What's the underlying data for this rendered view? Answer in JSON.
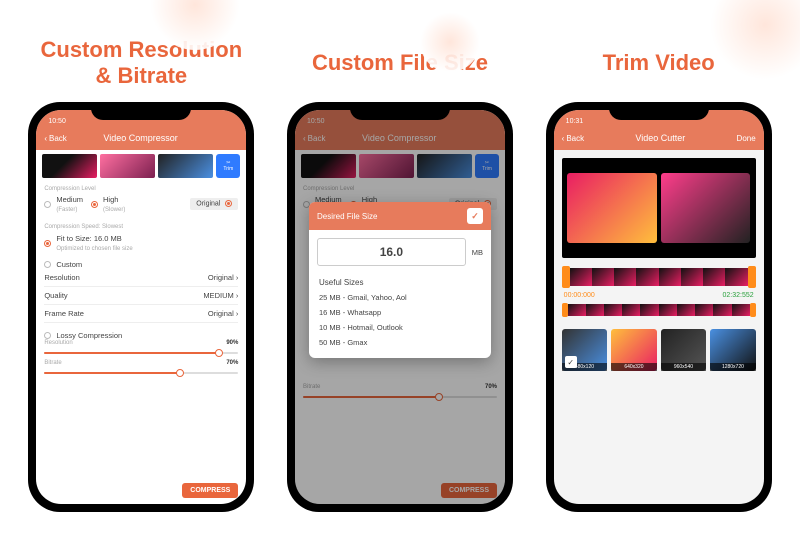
{
  "headlines": {
    "a1": "Custom Resolution",
    "a2": "& Bitrate",
    "b": "Custom File Size",
    "c": "Trim Video"
  },
  "time": {
    "s1": "10:50",
    "s2": "10:50",
    "s3": "10:31"
  },
  "nav": {
    "back": "Back",
    "compressor": "Video Compressor",
    "cutter": "Video Cutter",
    "done": "Done"
  },
  "trimBtn": "Trim",
  "compLevel": {
    "title": "Compression Level",
    "medium": "Medium",
    "medSub": "(Faster)",
    "high": "High",
    "highSub": "(Slower)",
    "original": "Original"
  },
  "speed": "Compression Speed: Slowest",
  "fit": {
    "label": "Fit to Size: 16.0 MB",
    "sub": "Optimized to chosen file size"
  },
  "custom": {
    "title": "Custom",
    "res": "Resolution",
    "resV": "Original",
    "qual": "Quality",
    "qualV": "MEDIUM",
    "fr": "Frame Rate",
    "frV": "Original"
  },
  "lossy": {
    "title": "Lossy Compression",
    "res": "Resolution",
    "resP": "90%",
    "bit": "Bitrate",
    "bitP": "70%"
  },
  "compress": "COMPRESS",
  "sheet": {
    "title": "Desired File Size",
    "value": "16.0",
    "unit": "MB",
    "useful": "Useful Sizes",
    "l1": "25 MB - Gmail, Yahoo, Aol",
    "l2": "16 MB - Whatsapp",
    "l3": "10 MB - Hotmail, Outlook",
    "l4": "50 MB - Gmax"
  },
  "cutter": {
    "start": "00:00:000",
    "end": "02:32:552",
    "res1": "480x120",
    "res2": "640x320",
    "res3": "960x540",
    "res4": "1280x720"
  }
}
